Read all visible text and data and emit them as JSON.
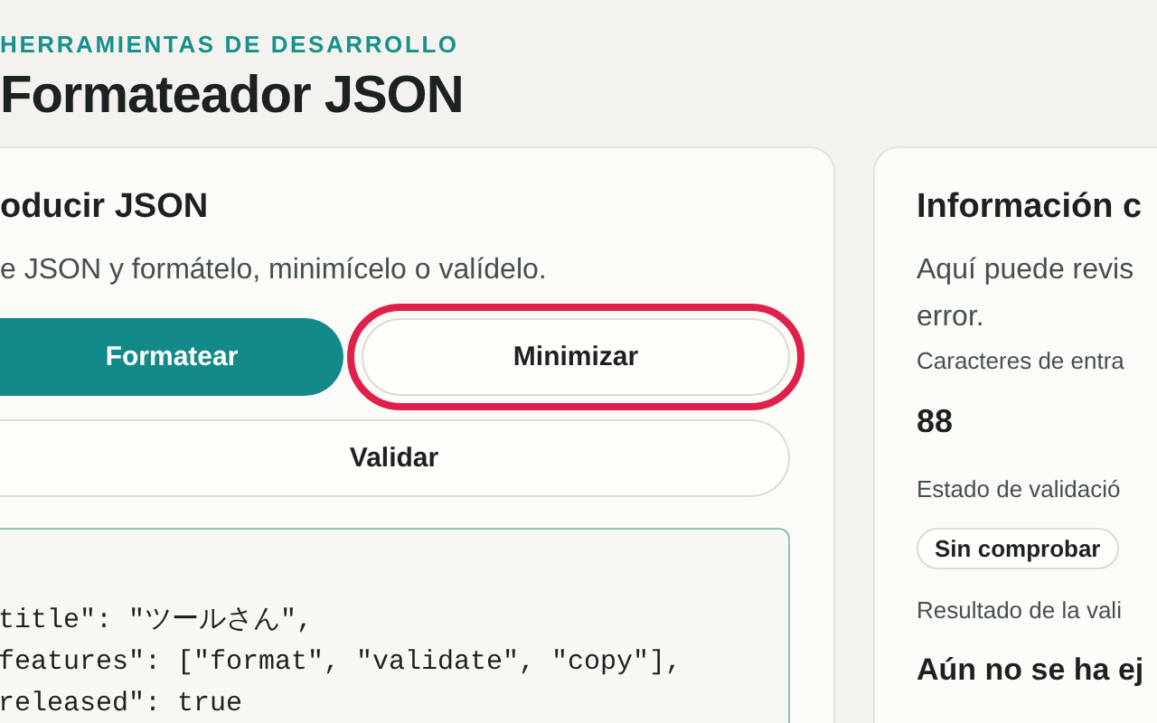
{
  "header": {
    "eyebrow": "HERRAMIENTAS DE DESARROLLO",
    "title": "Formateador JSON"
  },
  "input_card": {
    "title": "oducir JSON",
    "description": "e JSON y formátelo, minimícelo o valídelo.",
    "buttons": [
      {
        "label": "Formatear",
        "kind": "primary",
        "highlighted": false
      },
      {
        "label": "Minimizar",
        "kind": "secondary",
        "highlighted": true
      }
    ],
    "validate_button": {
      "label": "Validar"
    },
    "code_lines": [
      "title\": \"ツールさん\",",
      "features\": [\"format\", \"validate\", \"copy\"],",
      "released\": true"
    ]
  },
  "info_card": {
    "title": "Información c",
    "description": "Aquí puede revis",
    "description_2": "error.",
    "fields": [
      {
        "label": "Caracteres de entra",
        "value": "88",
        "kind": "number"
      },
      {
        "label": "Estado de validació",
        "value": "Sin comprobar",
        "kind": "badge"
      },
      {
        "label": "Resultado de la vali",
        "value": "Aún no se ha ej",
        "kind": "heading"
      }
    ]
  }
}
